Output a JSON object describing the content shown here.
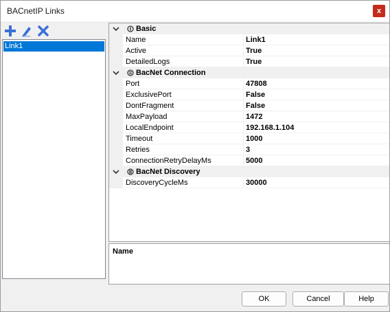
{
  "window": {
    "title": "BACnetIP Links",
    "close_glyph": "x"
  },
  "toolbar": {
    "add_icon": "plus-icon",
    "edit_icon": "pencil-icon",
    "delete_icon": "x-icon",
    "colors": {
      "accent": "#3a6fd8"
    }
  },
  "list": {
    "items": [
      {
        "label": "Link1",
        "selected": true
      }
    ]
  },
  "grid": {
    "categories": [
      {
        "label": "Basic",
        "icon": "category-icon",
        "expanded": true,
        "rows": [
          {
            "name": "Name",
            "value": "Link1"
          },
          {
            "name": "Active",
            "value": "True"
          },
          {
            "name": "DetailedLogs",
            "value": "True"
          }
        ]
      },
      {
        "label": "BacNet Connection",
        "icon": "category-icon",
        "expanded": true,
        "rows": [
          {
            "name": "Port",
            "value": "47808"
          },
          {
            "name": "ExclusivePort",
            "value": "False"
          },
          {
            "name": "DontFragment",
            "value": "False"
          },
          {
            "name": "MaxPayload",
            "value": "1472"
          },
          {
            "name": "LocalEndpoint",
            "value": "192.168.1.104"
          },
          {
            "name": "Timeout",
            "value": "1000"
          },
          {
            "name": "Retries",
            "value": "3"
          },
          {
            "name": "ConnectionRetryDelayMs",
            "value": "5000"
          }
        ]
      },
      {
        "label": "BacNet Discovery",
        "icon": "category-icon",
        "expanded": true,
        "rows": [
          {
            "name": "DiscoveryCycleMs",
            "value": "30000"
          }
        ]
      }
    ]
  },
  "description": {
    "title": "Name"
  },
  "buttons": {
    "ok": "OK",
    "cancel": "Cancel",
    "help": "Help"
  }
}
